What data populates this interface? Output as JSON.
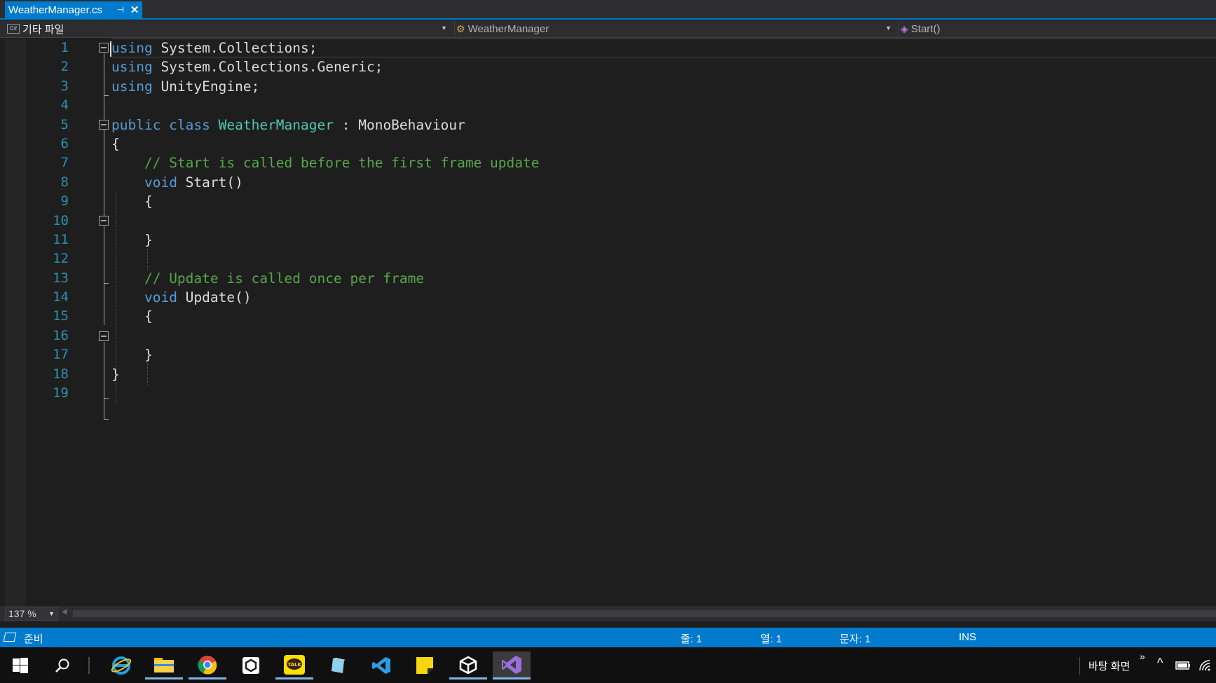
{
  "tab": {
    "title": "WeatherManager.cs",
    "pin": "⊣",
    "close": "✕"
  },
  "navbar": {
    "project": "기타 파일",
    "project_badge": "C#",
    "type": "WeatherManager",
    "member": "Start()"
  },
  "editor": {
    "line_numbers": [
      "1",
      "2",
      "3",
      "4",
      "5",
      "6",
      "7",
      "8",
      "9",
      "10",
      "11",
      "12",
      "13",
      "14",
      "15",
      "16",
      "17",
      "18",
      "19"
    ],
    "lines": [
      [
        [
          "kw",
          "using"
        ],
        [
          "pl",
          " System.Collections;"
        ]
      ],
      [
        [
          "kw",
          "using"
        ],
        [
          "pl",
          " System.Collections.Generic;"
        ]
      ],
      [
        [
          "kw",
          "using"
        ],
        [
          "pl",
          " UnityEngine;"
        ]
      ],
      [],
      [
        [
          "kw",
          "public class "
        ],
        [
          "ty",
          "WeatherManager"
        ],
        [
          "pl",
          " : MonoBehaviour"
        ]
      ],
      [
        [
          "pl",
          "{"
        ]
      ],
      [
        [
          "pl",
          "    "
        ],
        [
          "cm",
          "// Start is called before the first frame update"
        ]
      ],
      [
        [
          "pl",
          "    "
        ],
        [
          "kw",
          "void"
        ],
        [
          "pl",
          " Start()"
        ]
      ],
      [
        [
          "pl",
          "    {"
        ]
      ],
      [],
      [
        [
          "pl",
          "    }"
        ]
      ],
      [],
      [
        [
          "pl",
          "    "
        ],
        [
          "cm",
          "// Update is called once per frame"
        ]
      ],
      [
        [
          "pl",
          "    "
        ],
        [
          "kw",
          "void"
        ],
        [
          "pl",
          " Update()"
        ]
      ],
      [
        [
          "pl",
          "    {"
        ]
      ],
      [],
      [
        [
          "pl",
          "    }"
        ]
      ],
      [
        [
          "pl",
          "}"
        ]
      ],
      []
    ]
  },
  "zoom": {
    "value": "137 %"
  },
  "status": {
    "ready": "준비",
    "line": "줄: 1",
    "col": "열: 1",
    "char": "문자: 1",
    "mode": "INS"
  },
  "taskbar": {
    "desktop_label": "바탕 화면",
    "overflow": "»",
    "tray_up": "^"
  },
  "colors": {
    "accent": "#007acc",
    "keyword": "#569cd6",
    "type": "#4ec9b0",
    "comment": "#57a64a",
    "line_number": "#2b91af"
  }
}
